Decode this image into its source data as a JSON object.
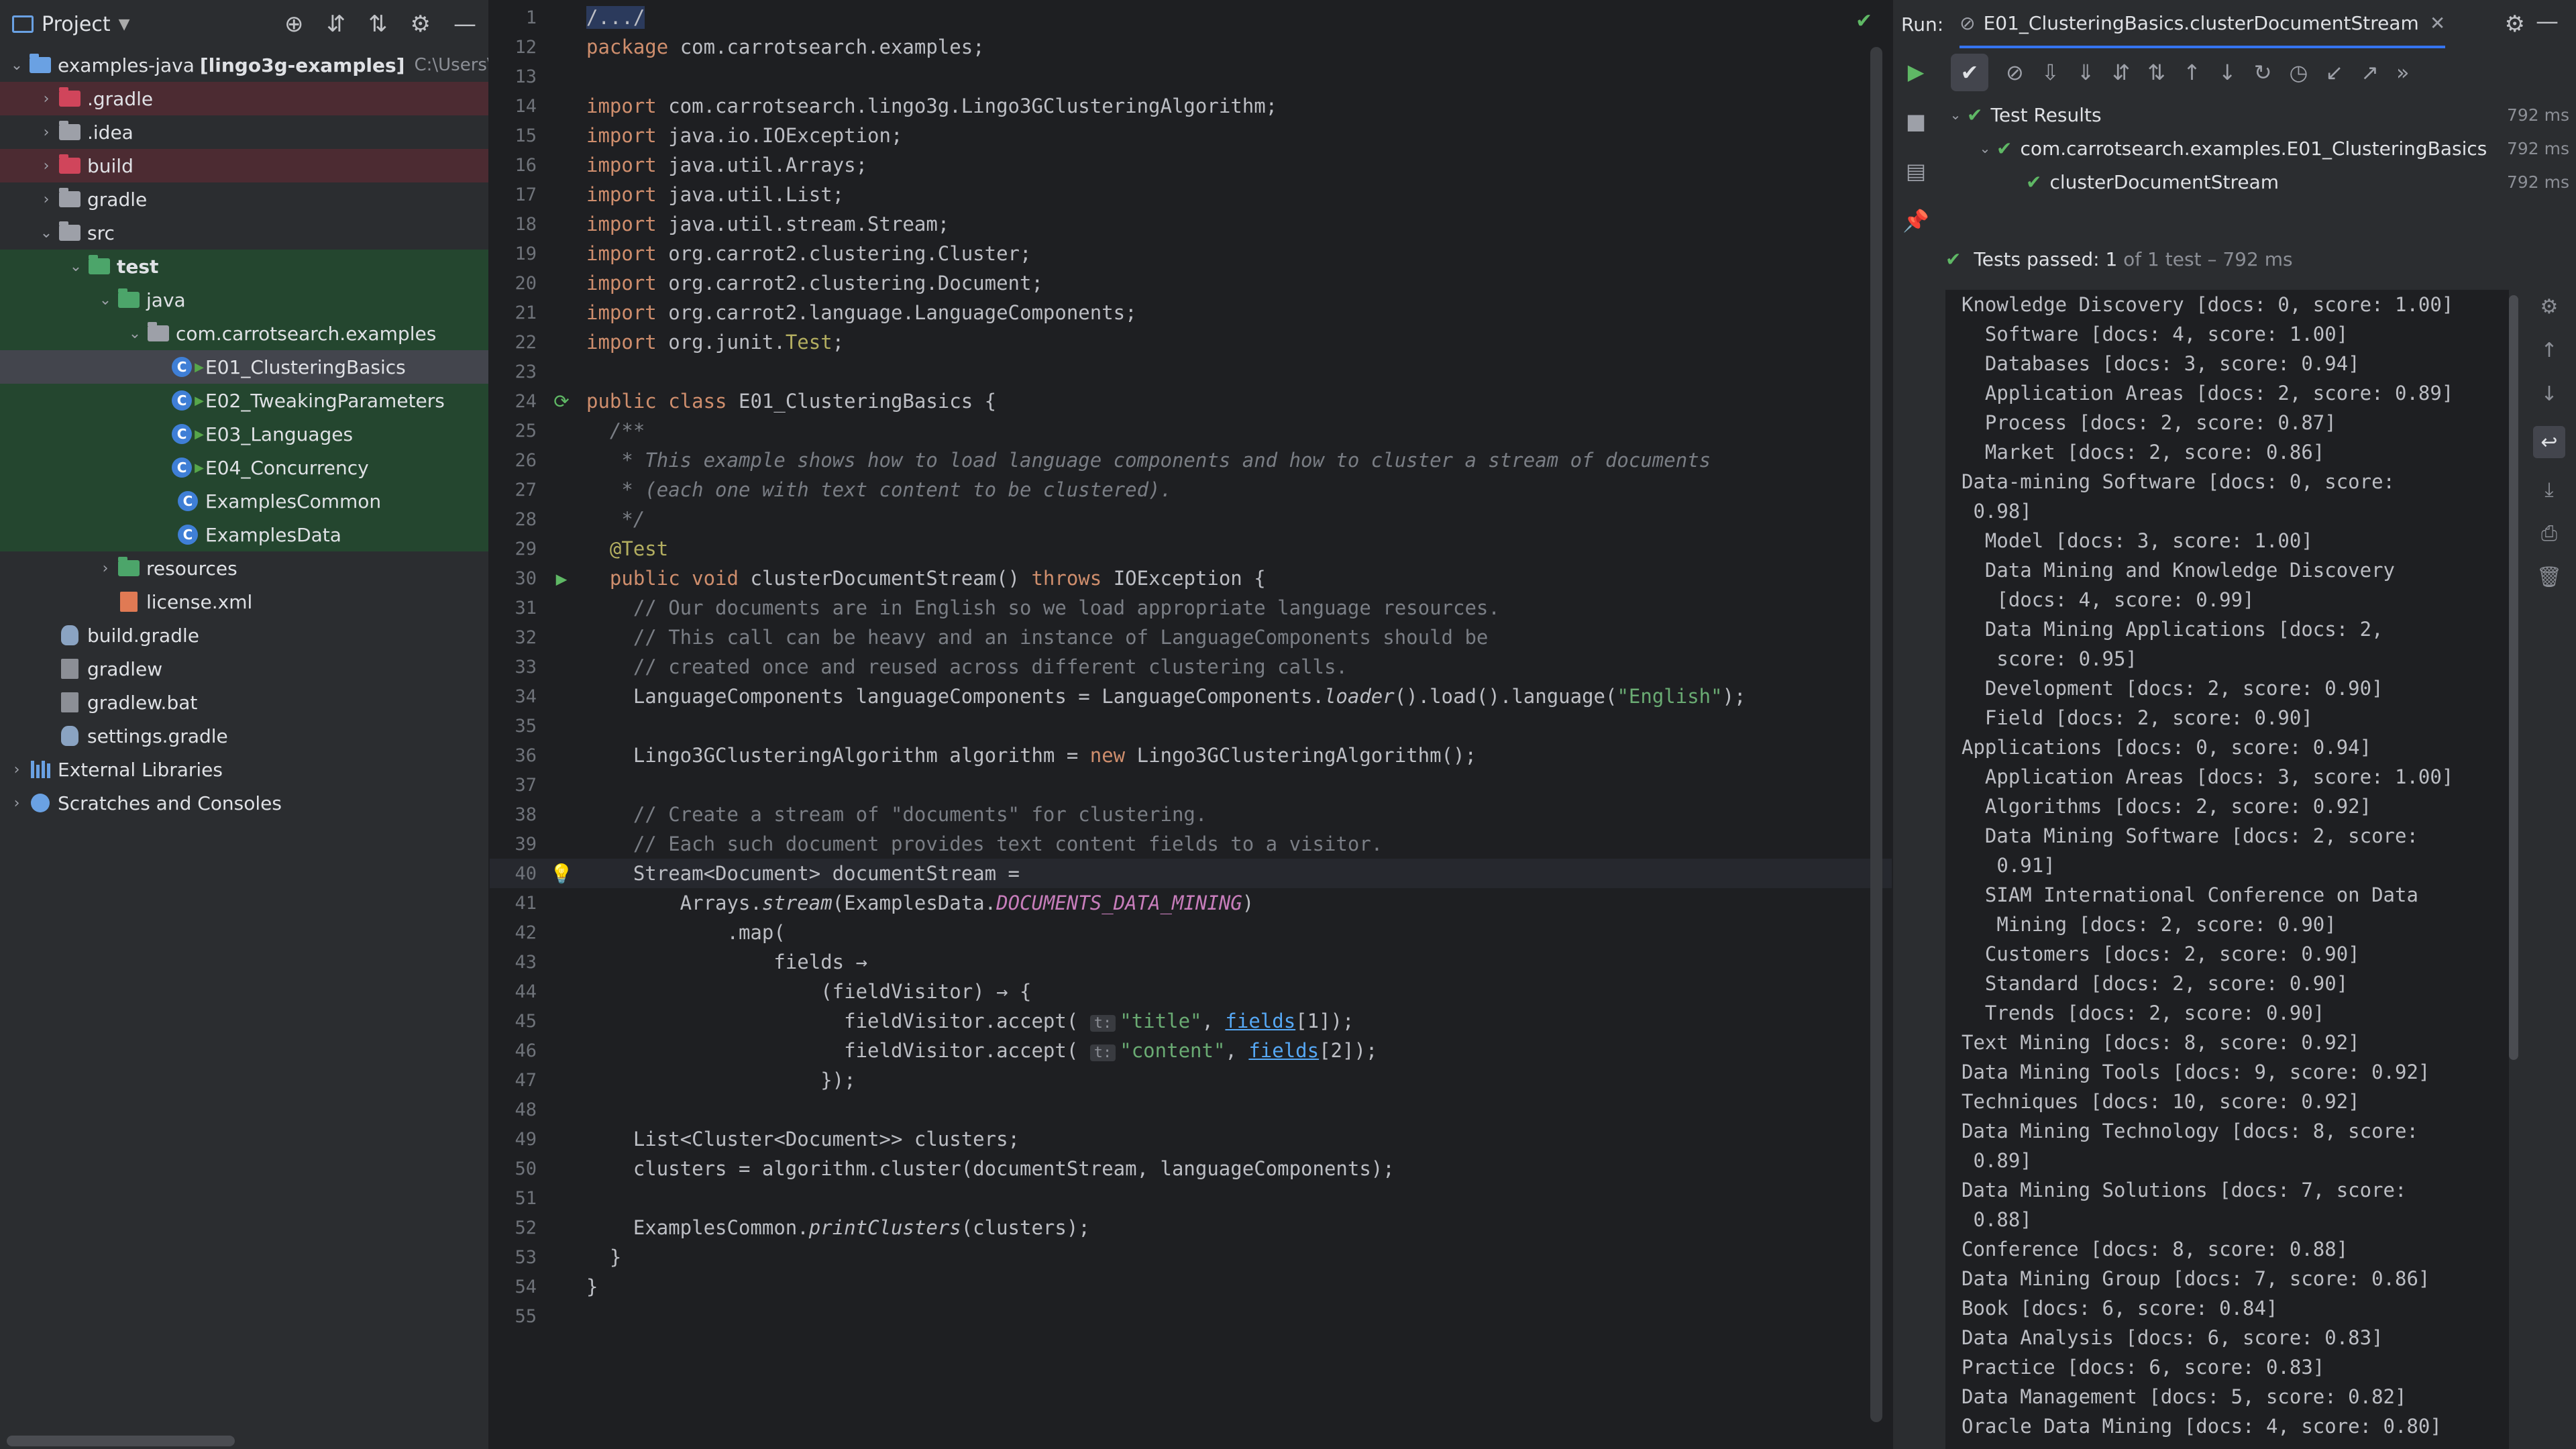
{
  "project": {
    "title": "Project",
    "tree": [
      {
        "label": ".gradle",
        "depth": 1,
        "arrow": "›",
        "icon": "folder-red",
        "bg": "red"
      },
      {
        "label": ".idea",
        "depth": 1,
        "arrow": "›",
        "icon": "folder"
      },
      {
        "label": "build",
        "depth": 1,
        "arrow": "›",
        "icon": "folder-red",
        "bg": "red"
      },
      {
        "label": "gradle",
        "depth": 1,
        "arrow": "›",
        "icon": "folder"
      },
      {
        "label": "src",
        "depth": 1,
        "arrow": "⌄",
        "icon": "folder"
      },
      {
        "label": "test",
        "depth": 2,
        "arrow": "⌄",
        "icon": "folder-green",
        "bg": "green",
        "bold": true
      },
      {
        "label": "java",
        "depth": 3,
        "arrow": "⌄",
        "icon": "folder-green",
        "bg": "green"
      },
      {
        "label": "com.carrotsearch.examples",
        "depth": 4,
        "arrow": "⌄",
        "icon": "package",
        "bg": "green"
      },
      {
        "label": "E01_ClusteringBasics",
        "depth": 5,
        "arrow": "",
        "icon": "class-test",
        "bg": "sel"
      },
      {
        "label": "E02_TweakingParameters",
        "depth": 5,
        "arrow": "",
        "icon": "class-test",
        "bg": "green"
      },
      {
        "label": "E03_Languages",
        "depth": 5,
        "arrow": "",
        "icon": "class-test",
        "bg": "green"
      },
      {
        "label": "E04_Concurrency",
        "depth": 5,
        "arrow": "",
        "icon": "class-test",
        "bg": "green"
      },
      {
        "label": "ExamplesCommon",
        "depth": 5,
        "arrow": "",
        "icon": "class",
        "bg": "green"
      },
      {
        "label": "ExamplesData",
        "depth": 5,
        "arrow": "",
        "icon": "class",
        "bg": "green"
      },
      {
        "label": "resources",
        "depth": 3,
        "arrow": "›",
        "icon": "folder-res"
      },
      {
        "label": "license.xml",
        "depth": 3,
        "arrow": "",
        "icon": "file-xml"
      },
      {
        "label": "build.gradle",
        "depth": 1,
        "arrow": "",
        "icon": "gradle"
      },
      {
        "label": "gradlew",
        "depth": 1,
        "arrow": "",
        "icon": "file"
      },
      {
        "label": "gradlew.bat",
        "depth": 1,
        "arrow": "",
        "icon": "file"
      },
      {
        "label": "settings.gradle",
        "depth": 1,
        "arrow": "",
        "icon": "gradle"
      },
      {
        "label": "External Libraries",
        "depth": 0,
        "arrow": "›",
        "icon": "library"
      },
      {
        "label": "Scratches and Consoles",
        "depth": 0,
        "arrow": "›",
        "icon": "scratch"
      }
    ],
    "root": {
      "name": "examples-java",
      "module": "[lingo3g-examples]",
      "path": "C:\\Users\\st"
    }
  },
  "editor": {
    "lines": [
      {
        "n": "1",
        "h": [
          [
            "fold",
            "/.../"
          ]
        ]
      },
      {
        "n": "12",
        "h": [
          [
            "kw",
            "package "
          ],
          [
            "",
            "com.carrotsearch.examples;"
          ]
        ]
      },
      {
        "n": "13",
        "h": []
      },
      {
        "n": "14",
        "h": [
          [
            "kw",
            "import "
          ],
          [
            "",
            "com.carrotsearch.lingo3g.Lingo3GClusteringAlgorithm;"
          ]
        ]
      },
      {
        "n": "15",
        "h": [
          [
            "kw",
            "import "
          ],
          [
            "",
            "java.io.IOException;"
          ]
        ]
      },
      {
        "n": "16",
        "h": [
          [
            "kw",
            "import "
          ],
          [
            "",
            "java.util.Arrays;"
          ]
        ]
      },
      {
        "n": "17",
        "h": [
          [
            "kw",
            "import "
          ],
          [
            "",
            "java.util.List;"
          ]
        ]
      },
      {
        "n": "18",
        "h": [
          [
            "kw",
            "import "
          ],
          [
            "",
            "java.util.stream.Stream;"
          ]
        ]
      },
      {
        "n": "19",
        "h": [
          [
            "kw",
            "import "
          ],
          [
            "",
            "org.carrot2.clustering.Cluster;"
          ]
        ]
      },
      {
        "n": "20",
        "h": [
          [
            "kw",
            "import "
          ],
          [
            "",
            "org.carrot2.clustering.Document;"
          ]
        ]
      },
      {
        "n": "21",
        "h": [
          [
            "kw",
            "import "
          ],
          [
            "",
            "org.carrot2.language.LanguageComponents;"
          ]
        ]
      },
      {
        "n": "22",
        "h": [
          [
            "kw",
            "import "
          ],
          [
            "",
            "org.junit."
          ],
          [
            "ann",
            "Test"
          ],
          [
            "",
            ";"
          ]
        ]
      },
      {
        "n": "23",
        "h": []
      },
      {
        "n": "24",
        "g": "run2",
        "h": [
          [
            "kw",
            "public class "
          ],
          [
            "",
            "E01_ClusteringBasics {"
          ]
        ]
      },
      {
        "n": "25",
        "h": [
          [
            "com",
            "  /**"
          ]
        ]
      },
      {
        "n": "26",
        "h": [
          [
            "com",
            "   * This example shows how to load language components and how to cluster a stream of documents"
          ]
        ]
      },
      {
        "n": "27",
        "h": [
          [
            "com",
            "   * (each one with text content to be clustered)."
          ]
        ]
      },
      {
        "n": "28",
        "h": [
          [
            "com",
            "   */"
          ]
        ]
      },
      {
        "n": "29",
        "h": [
          [
            "ann",
            "  @Test"
          ]
        ]
      },
      {
        "n": "30",
        "g": "run",
        "h": [
          [
            "kw",
            "  public void "
          ],
          [
            "",
            "clusterDocumentStream() "
          ],
          [
            "kw",
            "throws "
          ],
          [
            "",
            "IOException {"
          ]
        ]
      },
      {
        "n": "31",
        "h": [
          [
            "lc",
            "    // Our documents are in English so we load appropriate language resources."
          ]
        ]
      },
      {
        "n": "32",
        "h": [
          [
            "lc",
            "    // This call can be heavy and an instance of LanguageComponents should be"
          ]
        ]
      },
      {
        "n": "33",
        "h": [
          [
            "lc",
            "    // created once and reused across different clustering calls."
          ]
        ]
      },
      {
        "n": "34",
        "h": [
          [
            "",
            "    LanguageComponents languageComponents = LanguageComponents."
          ],
          [
            "meth-i",
            "loader"
          ],
          [
            "",
            "().load().language("
          ],
          [
            "str",
            "\"English\""
          ],
          [
            "",
            ");"
          ]
        ]
      },
      {
        "n": "35",
        "h": []
      },
      {
        "n": "36",
        "h": [
          [
            "",
            "    Lingo3GClusteringAlgorithm algorithm = "
          ],
          [
            "kw",
            "new "
          ],
          [
            "",
            "Lingo3GClusteringAlgorithm();"
          ]
        ]
      },
      {
        "n": "37",
        "h": []
      },
      {
        "n": "38",
        "h": [
          [
            "lc",
            "    // Create a stream of \"documents\" for clustering."
          ]
        ]
      },
      {
        "n": "39",
        "h": [
          [
            "lc",
            "    // Each such document provides text content fields to a visitor."
          ]
        ]
      },
      {
        "n": "40",
        "g": "bulb",
        "cur": true,
        "h": [
          [
            "",
            "    Stream<Document> documentStream ="
          ]
        ]
      },
      {
        "n": "41",
        "h": [
          [
            "",
            "        Arrays."
          ],
          [
            "meth-i",
            "stream"
          ],
          [
            "",
            "(ExamplesData."
          ],
          [
            "stat",
            "DOCUMENTS_DATA_MINING"
          ],
          [
            "",
            ")"
          ]
        ]
      },
      {
        "n": "42",
        "h": [
          [
            "",
            "            .map("
          ]
        ]
      },
      {
        "n": "43",
        "h": [
          [
            "",
            "                fields →"
          ]
        ]
      },
      {
        "n": "44",
        "h": [
          [
            "",
            "                    (fieldVisitor) → {"
          ]
        ]
      },
      {
        "n": "45",
        "h": [
          [
            "",
            "                      fieldVisitor.accept( "
          ],
          [
            "hint-b",
            "t:"
          ],
          [
            "str",
            "\"title\""
          ],
          [
            "",
            ", "
          ],
          [
            "ulink",
            "fields"
          ],
          [
            "",
            "[1]);"
          ]
        ]
      },
      {
        "n": "46",
        "h": [
          [
            "",
            "                      fieldVisitor.accept( "
          ],
          [
            "hint-b",
            "t:"
          ],
          [
            "str",
            "\"content\""
          ],
          [
            "",
            ", "
          ],
          [
            "ulink",
            "fields"
          ],
          [
            "",
            "[2]);"
          ]
        ]
      },
      {
        "n": "47",
        "h": [
          [
            "",
            "                    });"
          ]
        ]
      },
      {
        "n": "48",
        "h": []
      },
      {
        "n": "49",
        "h": [
          [
            "",
            "    List<Cluster<Document>> clusters;"
          ]
        ]
      },
      {
        "n": "50",
        "h": [
          [
            "",
            "    clusters = algorithm.cluster(documentStream, languageComponents);"
          ]
        ]
      },
      {
        "n": "51",
        "h": []
      },
      {
        "n": "52",
        "h": [
          [
            "",
            "    ExamplesCommon."
          ],
          [
            "meth-i",
            "printClusters"
          ],
          [
            "",
            "(clusters);"
          ]
        ]
      },
      {
        "n": "53",
        "h": [
          [
            "",
            "  }"
          ]
        ]
      },
      {
        "n": "54",
        "h": [
          [
            "",
            "}"
          ]
        ]
      },
      {
        "n": "55",
        "h": []
      }
    ]
  },
  "run": {
    "label": "Run:",
    "tab": "E01_ClusteringBasics.clusterDocumentStream",
    "tests": [
      {
        "label": "Test Results",
        "depth": 0,
        "arrow": "⌄",
        "ms": "792 ms"
      },
      {
        "label": "com.carrotsearch.examples.E01_ClusteringBasics",
        "depth": 1,
        "arrow": "⌄",
        "ms": "792 ms"
      },
      {
        "label": "clusterDocumentStream",
        "depth": 2,
        "arrow": "",
        "ms": "792 ms"
      }
    ],
    "status": {
      "main": "Tests passed: 1",
      "sub": "of 1 test – 792 ms"
    },
    "console": [
      "Knowledge Discovery [docs: 0, score: 1.00]",
      "  Software [docs: 4, score: 1.00]",
      "  Databases [docs: 3, score: 0.94]",
      "  Application Areas [docs: 2, score: 0.89]",
      "  Process [docs: 2, score: 0.87]",
      "  Market [docs: 2, score: 0.86]",
      "Data-mining Software [docs: 0, score:",
      " 0.98]",
      "  Model [docs: 3, score: 1.00]",
      "  Data Mining and Knowledge Discovery",
      "   [docs: 4, score: 0.99]",
      "  Data Mining Applications [docs: 2,",
      "   score: 0.95]",
      "  Development [docs: 2, score: 0.90]",
      "  Field [docs: 2, score: 0.90]",
      "Applications [docs: 0, score: 0.94]",
      "  Application Areas [docs: 3, score: 1.00]",
      "  Algorithms [docs: 2, score: 0.92]",
      "  Data Mining Software [docs: 2, score:",
      "   0.91]",
      "  SIAM International Conference on Data",
      "   Mining [docs: 2, score: 0.90]",
      "  Customers [docs: 2, score: 0.90]",
      "  Standard [docs: 2, score: 0.90]",
      "  Trends [docs: 2, score: 0.90]",
      "Text Mining [docs: 8, score: 0.92]",
      "Data Mining Tools [docs: 9, score: 0.92]",
      "Techniques [docs: 10, score: 0.92]",
      "Data Mining Technology [docs: 8, score:",
      " 0.89]",
      "Data Mining Solutions [docs: 7, score:",
      " 0.88]",
      "Conference [docs: 8, score: 0.88]",
      "Data Mining Group [docs: 7, score: 0.86]",
      "Book [docs: 6, score: 0.84]",
      "Data Analysis [docs: 6, score: 0.83]",
      "Practice [docs: 6, score: 0.83]",
      "Data Management [docs: 5, score: 0.82]",
      "Oracle Data Mining [docs: 4, score: 0.80]"
    ]
  }
}
